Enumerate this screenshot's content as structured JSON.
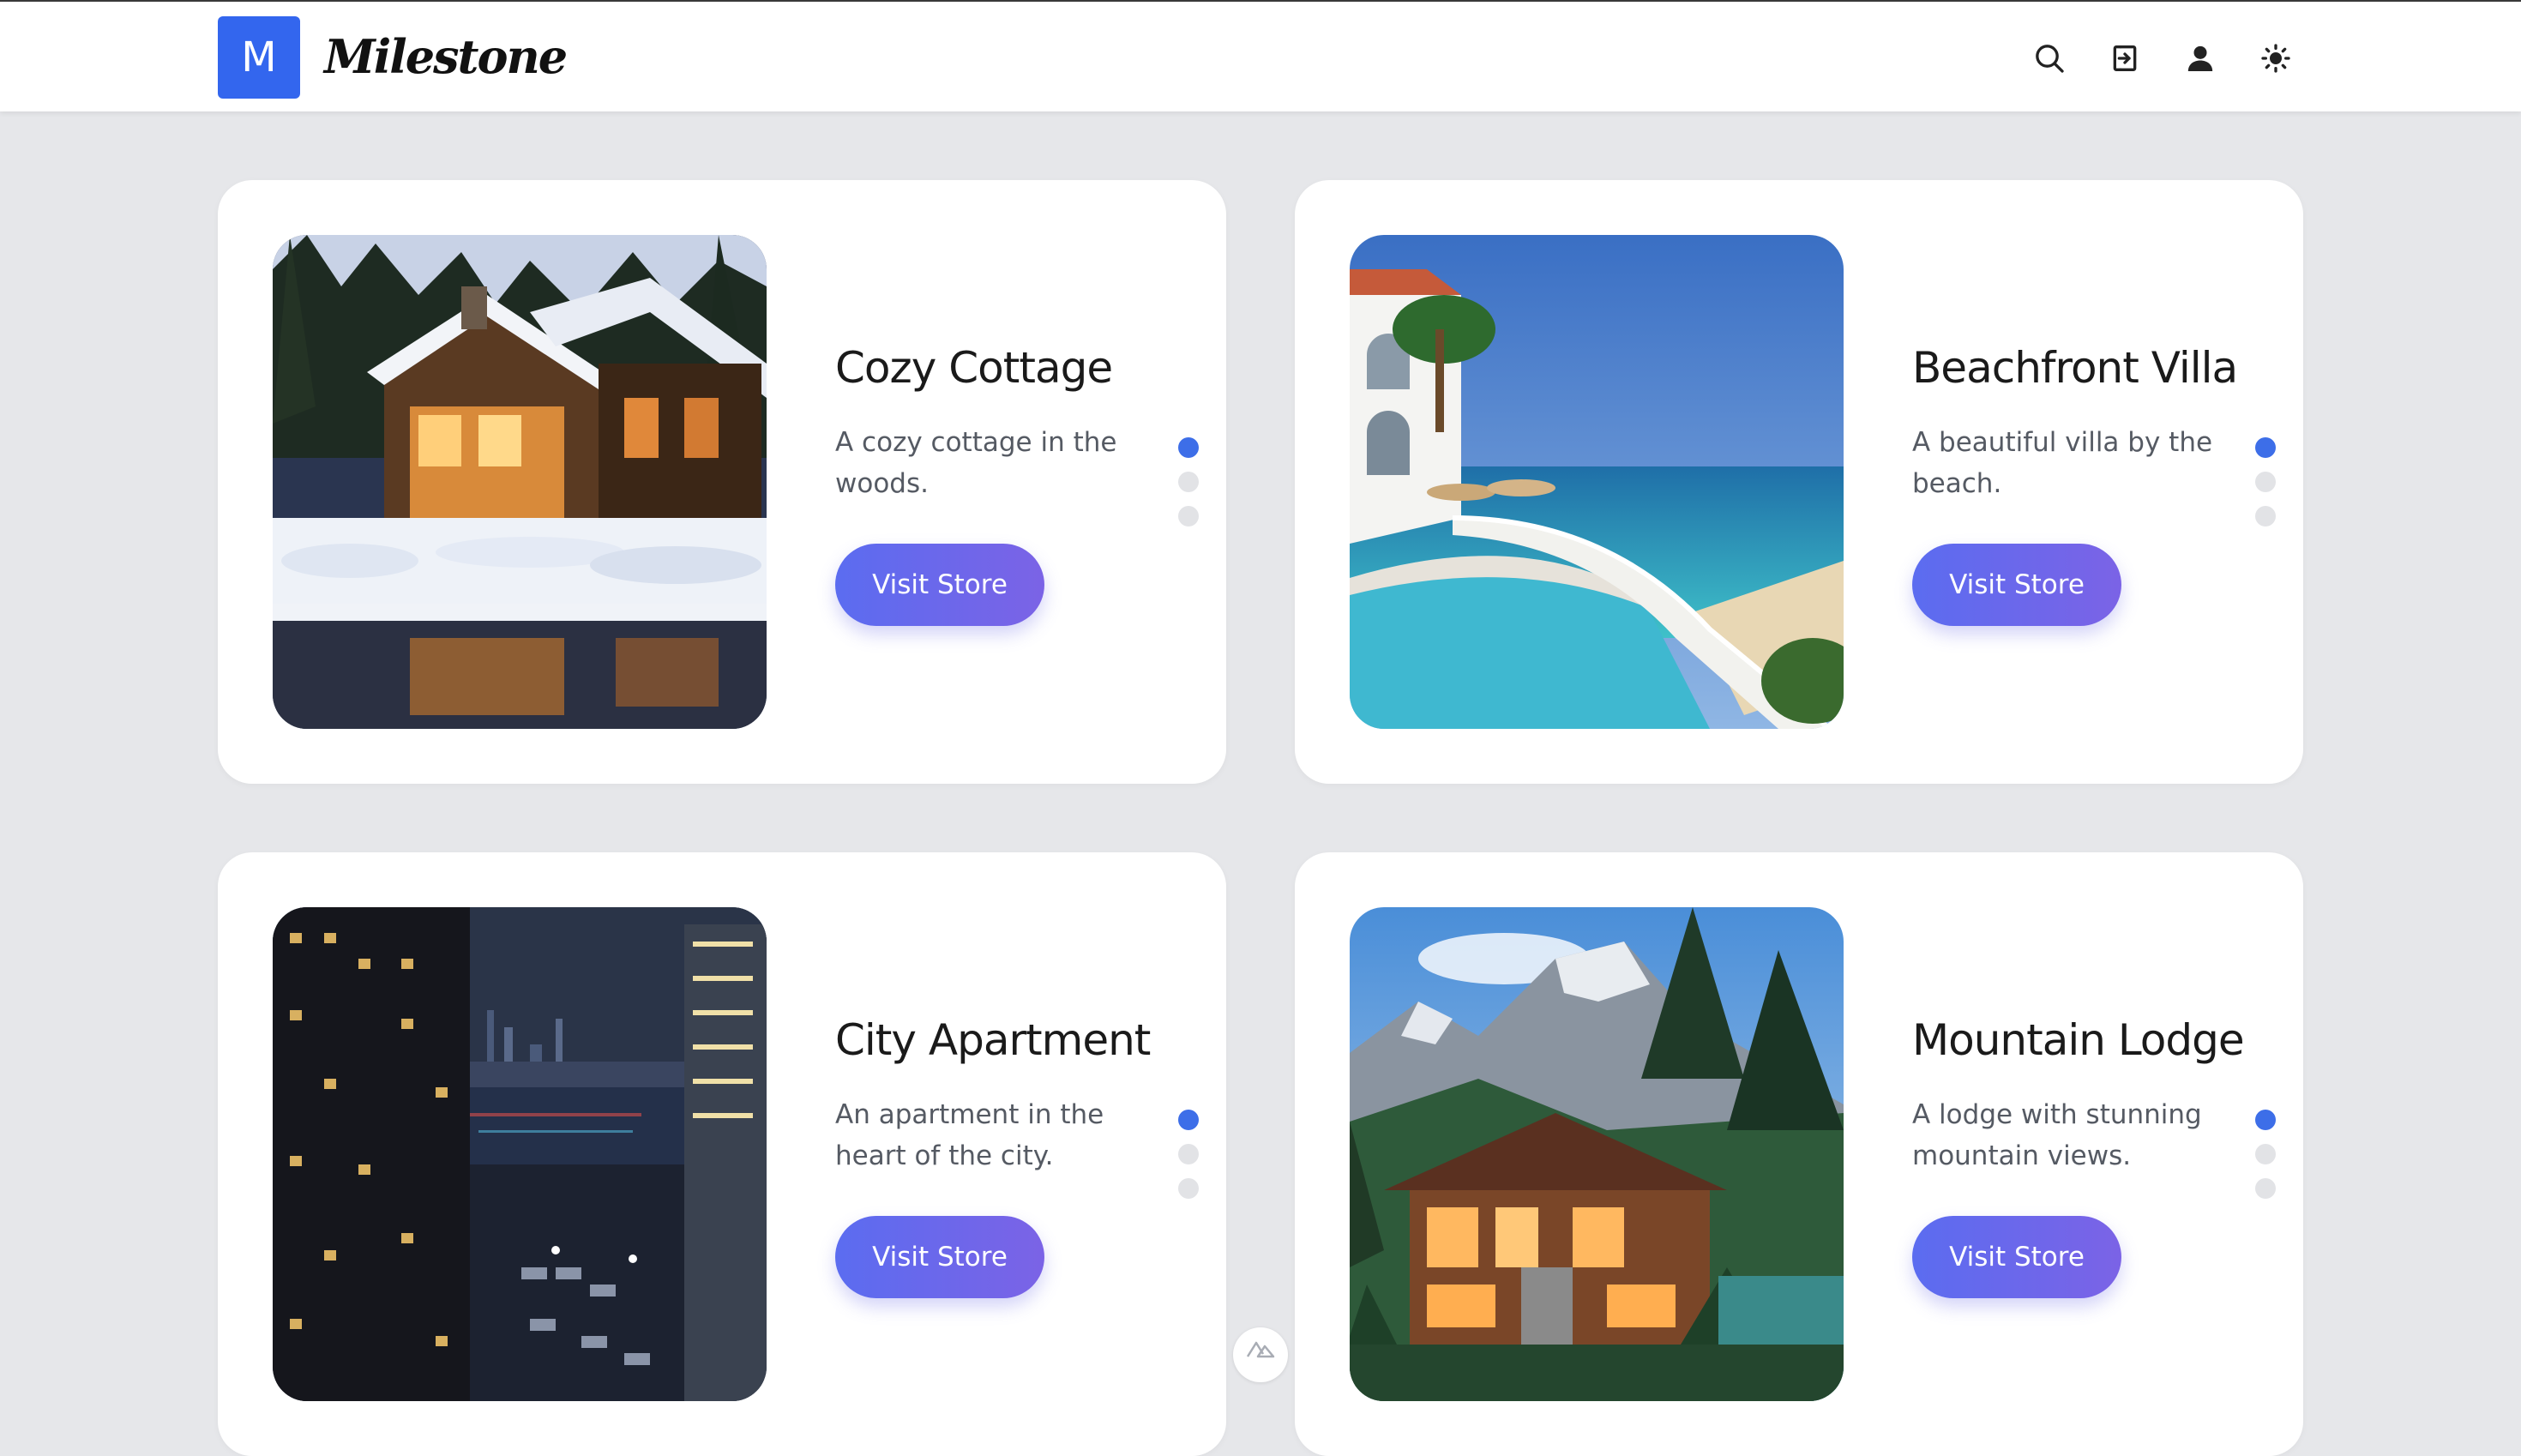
{
  "brand": {
    "logo_letter": "M",
    "name": "Milestone",
    "accent_color": "#3366ee"
  },
  "header": {
    "icons": [
      "search-icon",
      "sign-in-icon",
      "user-icon",
      "theme-toggle-icon"
    ]
  },
  "cards": [
    {
      "title": "Cozy Cottage",
      "description": "A cozy cottage in the woods.",
      "button": "Visit Store",
      "image": "snowy-cottage"
    },
    {
      "title": "Beachfront Villa",
      "description": "A beautiful villa by the beach.",
      "button": "Visit Store",
      "image": "beach-villa-pool"
    },
    {
      "title": "City Apartment",
      "description": "An apartment in the heart of the city.",
      "button": "Visit Store",
      "image": "night-city-skyline"
    },
    {
      "title": "Mountain Lodge",
      "description": "A lodge with stunning mountain views.",
      "button": "Visit Store",
      "image": "mountain-lodge"
    }
  ],
  "carousel": {
    "dots_per_card": 3,
    "active_index": 0,
    "active_color": "#3d6ee8"
  }
}
